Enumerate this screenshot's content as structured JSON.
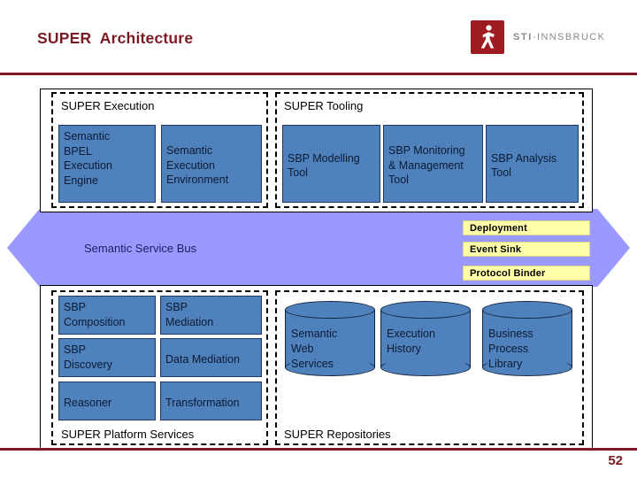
{
  "header": {
    "title": "SUPER  Architecture",
    "logo_icon": "sti-innsbruck-logo-icon",
    "logo_text_bold": "STI",
    "logo_text_sep": "·",
    "logo_text_rest": "INNSBRUCK"
  },
  "footer": {
    "page_number": "52"
  },
  "service_bus": {
    "label": "Semantic Service Bus",
    "arrow_color": "#9999FF",
    "chips": [
      {
        "label": "Deployment"
      },
      {
        "label": "Event Sink"
      },
      {
        "label": "Protocol Binder"
      }
    ],
    "chip_color": "#FFFFAA"
  },
  "groups": {
    "execution": {
      "label": "SUPER Execution",
      "boxes": [
        {
          "label": "Semantic\nBPEL\nExecution\nEngine"
        },
        {
          "label": "Semantic\nExecution\nEnvironment"
        }
      ]
    },
    "tooling": {
      "label": "SUPER Tooling",
      "boxes": [
        {
          "label": "SBP Modelling\nTool"
        },
        {
          "label": "SBP Monitoring\n& Management\nTool"
        },
        {
          "label": "SBP Analysis\nTool"
        }
      ]
    },
    "platform": {
      "label": "SUPER Platform Services",
      "boxes": [
        {
          "label": "SBP\nComposition"
        },
        {
          "label": "SBP\nMediation"
        },
        {
          "label": "SBP\nDiscovery"
        },
        {
          "label": "Data Mediation"
        },
        {
          "label": "Reasoner"
        },
        {
          "label": "Transformation"
        }
      ]
    },
    "repositories": {
      "label": "SUPER Repositories",
      "cylinders": [
        {
          "label": "Semantic\nWeb\nServices"
        },
        {
          "label": "Execution\nHistory"
        },
        {
          "label": "Business\nProcess\nLibrary"
        }
      ]
    }
  },
  "colors": {
    "accent": "#7B1A22",
    "component_blue": "#4F81BD",
    "bus_purple": "#9999FF",
    "chip_yellow": "#FFFFAA",
    "logo_red": "#9E1B20"
  }
}
